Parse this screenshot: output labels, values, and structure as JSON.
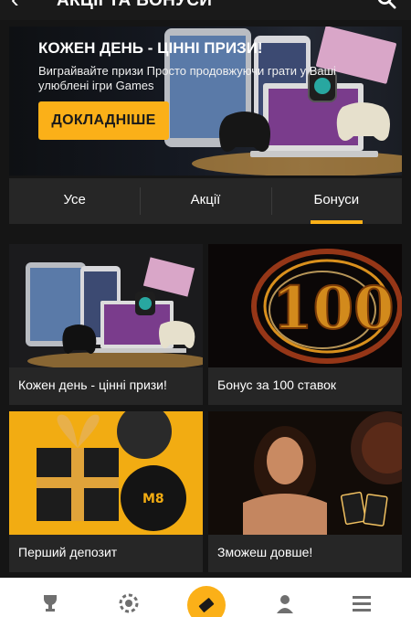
{
  "header": {
    "title": "АКЦІЇ ТА БОНУСИ"
  },
  "hero": {
    "title": "КОЖЕН ДЕНЬ - ЦІННІ ПРИЗИ!",
    "subtitle": "Виграйвайте призи Просто продовжуючи грати у Ваші улюблені ігри Games",
    "button": "ДОКЛАДНІШЕ"
  },
  "tabs": [
    {
      "label": "Усе",
      "active": false
    },
    {
      "label": "Акції",
      "active": false
    },
    {
      "label": "Бонуси",
      "active": true
    }
  ],
  "promos": [
    {
      "title": "Кожен день - цінні призи!"
    },
    {
      "title": "Бонус за 100 ставок"
    },
    {
      "title": "Перший депозит"
    },
    {
      "title": "Зможеш довше!"
    }
  ],
  "bottom_nav": {
    "items": [
      "trophy-icon",
      "chip-icon",
      "ticket-icon",
      "user-icon",
      "menu-icon"
    ]
  },
  "colors": {
    "accent": "#fbb018",
    "background": "#151515",
    "card": "#262626"
  }
}
